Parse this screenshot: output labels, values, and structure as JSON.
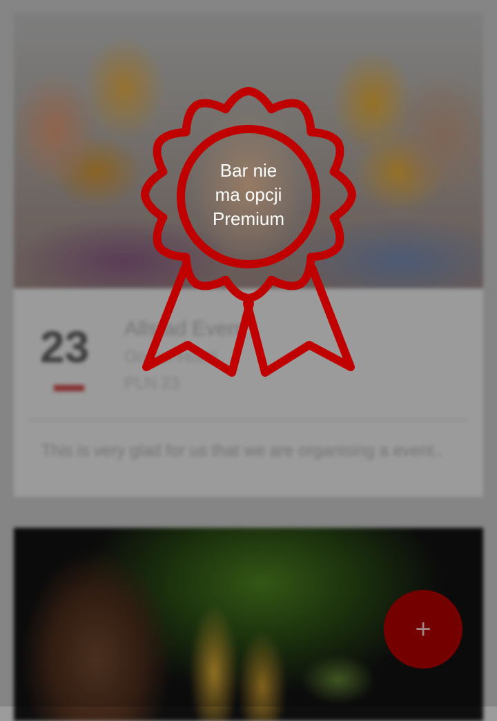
{
  "events": [
    {
      "day": "23",
      "title": "Allstad Event",
      "subtitle": "Ocean Hotel",
      "price": "PLN 23",
      "description": "This is very glad for us that we are organising a event.."
    }
  ],
  "fab": {
    "icon": "plus-icon",
    "glyph": "+"
  },
  "premium_badge": {
    "icon": "award-ribbon-icon",
    "lines": [
      "Bar nie",
      "ma opcji",
      "Premium"
    ],
    "color": "#c00000"
  },
  "colors": {
    "accent": "#c00000",
    "date_bar": "#a33a3a"
  }
}
